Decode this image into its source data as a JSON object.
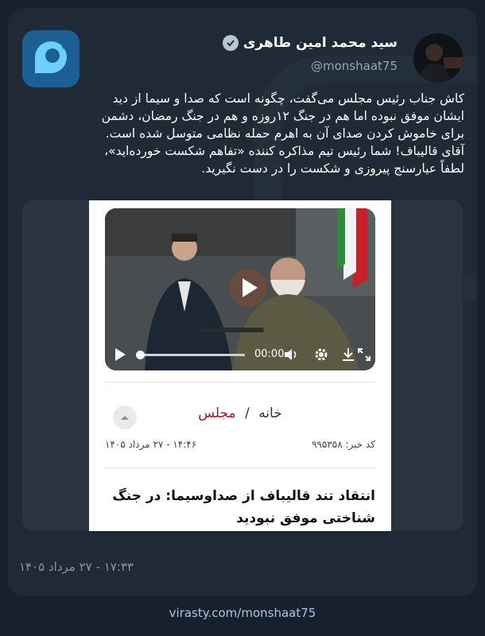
{
  "author": {
    "name": "سید محمد امین طاهری",
    "handle": "@monshaat75"
  },
  "tweet": {
    "lines": [
      "کاش جناب رئیس مجلس می‌گفت، چگونه است که صدا و سیما از دید",
      "ایشان موفق نبوده اما هم در جنگ ۱۲روزه و هم در جنگ رمضان، دشمن",
      "برای خاموش کردن صدای آن به اهرم حمله نظامی متوسل شده است.",
      "آقای قالیباف! شما رئیس تیم مذاکره کننده «تفاهم شکست خورده‌اید»،",
      "لطفاً عیارسنج پیروزی و شکست را در دست نگیرید."
    ]
  },
  "media": {
    "video_time": "00:00",
    "breadcrumb_home": "خانه",
    "breadcrumb_sep": "/",
    "breadcrumb_section": "مجلس",
    "news_code": "کد خبر: ۹۹۵۳۵۸",
    "news_datetime": "۱۴:۴۶ - ۲۷ مرداد ۱۴۰۵",
    "headline_1": "انتقاد تند قالیباف از صداوسیما: در جنگ",
    "headline_2": "شناختی موفق نبودید"
  },
  "timestamp": "۱۷:۳۳ - ۲۷ مرداد ۱۴۰۵",
  "footer_link": "virasty.com/monshaat75",
  "colors": {
    "background": "#17212b",
    "card": "#1f2a36",
    "accent_link": "#a8c4e6",
    "breadcrumb_section": "#9b1c1c"
  },
  "icons": [
    "app-logo-icon",
    "verified-badge-icon",
    "play-icon",
    "volume-icon",
    "gear-icon",
    "download-icon",
    "fullscreen-icon",
    "chevron-up-icon"
  ]
}
